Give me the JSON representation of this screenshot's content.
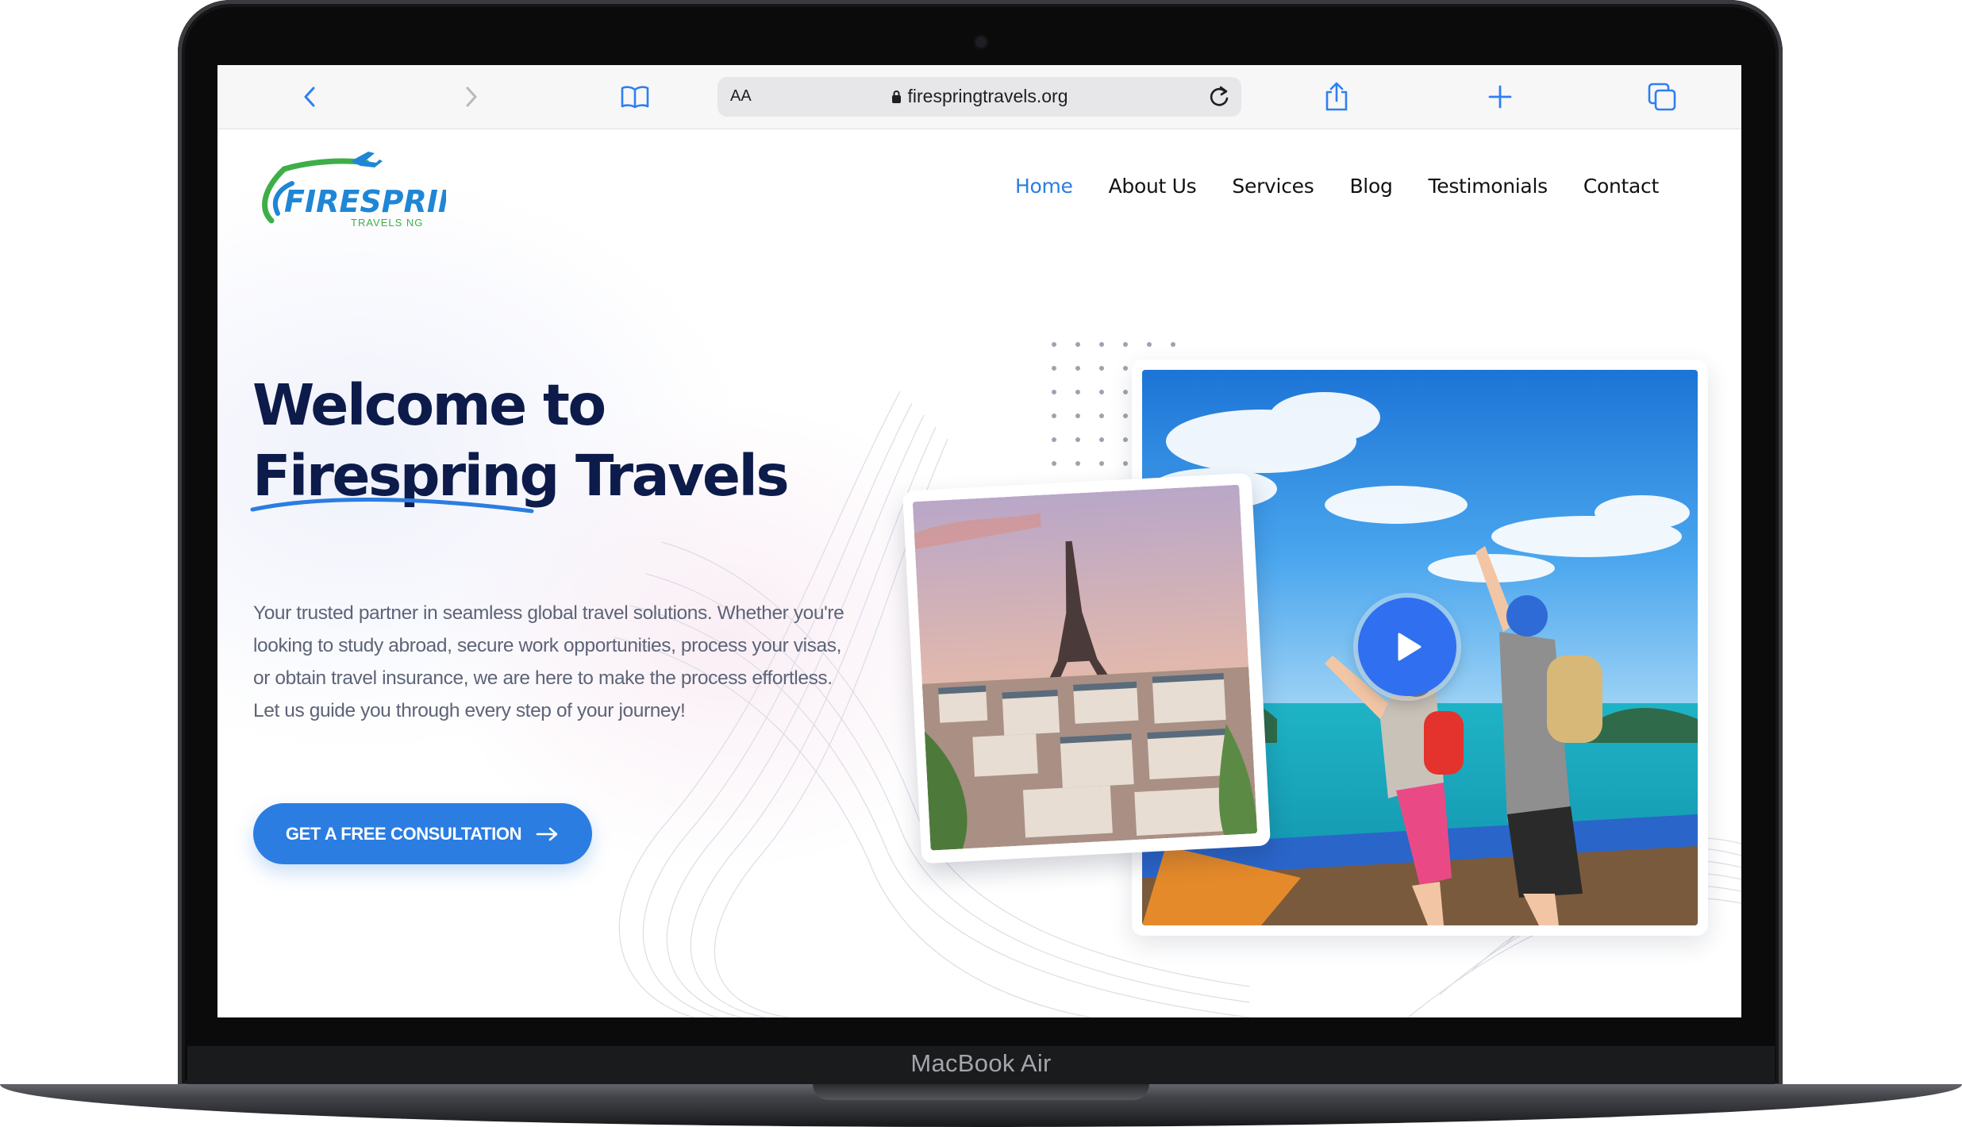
{
  "device": {
    "label": "MacBook Air"
  },
  "browser": {
    "reader_label": "AA",
    "url": "firespringtravels.org",
    "icons": {
      "back": "chevron-left-icon",
      "forward": "chevron-right-icon",
      "bookmarks": "book-icon",
      "lock": "lock-icon",
      "reload": "reload-icon",
      "share": "share-icon",
      "new_tab": "plus-icon",
      "tabs": "tabs-icon"
    },
    "accent": "#2f7ff0"
  },
  "site": {
    "logo": {
      "wordmark": "FIRESPRING",
      "sub": "TRAVELS NG"
    },
    "nav": [
      {
        "label": "Home",
        "active": true
      },
      {
        "label": "About Us",
        "active": false
      },
      {
        "label": "Services",
        "active": false
      },
      {
        "label": "Blog",
        "active": false
      },
      {
        "label": "Testimonials",
        "active": false
      },
      {
        "label": "Contact",
        "active": false
      }
    ],
    "hero": {
      "title_line1": "Welcome to",
      "title_brand": "Firespring",
      "title_tail": " Travels",
      "description": "Your trusted partner in seamless global travel solutions. Whether you're looking to study abroad, secure work opportunities, process your visas, or obtain travel insurance, we are here to make the process effortless.",
      "tagline": "Let us guide you through every step of your journey!",
      "cta_label": "GET A FREE CONSULTATION",
      "cta_icon": "arrow-right-icon"
    },
    "media": {
      "main_image": "travelers-on-boat-photo",
      "secondary_image": "paris-eiffel-tower-photo",
      "play_icon": "play-icon"
    },
    "colors": {
      "brand_blue": "#2b7de1",
      "heading_navy": "#0c1b4a",
      "body_text": "#5d6477",
      "logo_green": "#3fae49",
      "logo_blue": "#1f86d6"
    }
  }
}
